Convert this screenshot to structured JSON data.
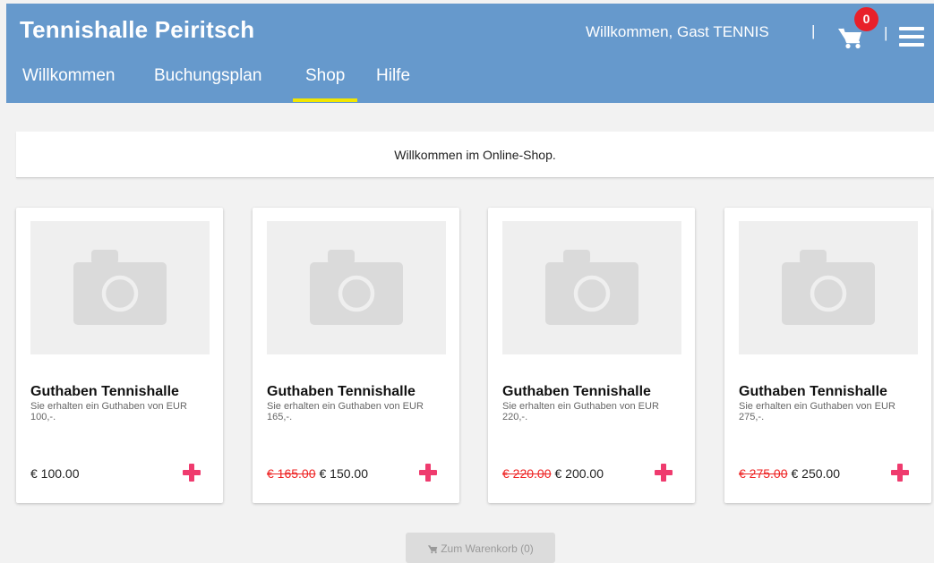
{
  "header": {
    "brand": "Tennishalle Peiritsch",
    "welcome": "Willkommen, Gast TENNIS",
    "separator": "|",
    "cart_count": "0"
  },
  "nav": {
    "items": [
      {
        "label": "Willkommen",
        "active": false
      },
      {
        "label": "Buchungsplan",
        "active": false
      },
      {
        "label": "Shop",
        "active": true
      },
      {
        "label": "Hilfe",
        "active": false
      }
    ]
  },
  "intro": {
    "text": "Willkommen im Online-Shop."
  },
  "products": [
    {
      "title": "Guthaben Tennishalle",
      "description": "Sie erhalten ein Guthaben von EUR 100,-.",
      "old_price": "",
      "price": "€ 100.00"
    },
    {
      "title": "Guthaben Tennishalle",
      "description": "Sie erhalten ein Guthaben von EUR 165,-.",
      "old_price": "€ 165.00",
      "price": "€ 150.00"
    },
    {
      "title": "Guthaben Tennishalle",
      "description": "Sie erhalten ein Guthaben von EUR 220,-.",
      "old_price": "€ 220.00",
      "price": "€ 200.00"
    },
    {
      "title": "Guthaben Tennishalle",
      "description": "Sie erhalten ein Guthaben von EUR 275,-.",
      "old_price": "€ 275.00",
      "price": "€ 250.00"
    }
  ],
  "cart_button": {
    "label": "Zum Warenkorb (0)"
  },
  "colors": {
    "header_bg": "#6699cc",
    "nav_active_underline": "#f2e600",
    "badge": "#e8202a",
    "add_icon": "#ef3b6e",
    "strike_price": "#e22222"
  },
  "icons": {
    "cart": "shopping-cart-icon",
    "menu": "hamburger-menu-icon",
    "product_image": "camera-placeholder-icon",
    "add": "plus-icon"
  }
}
